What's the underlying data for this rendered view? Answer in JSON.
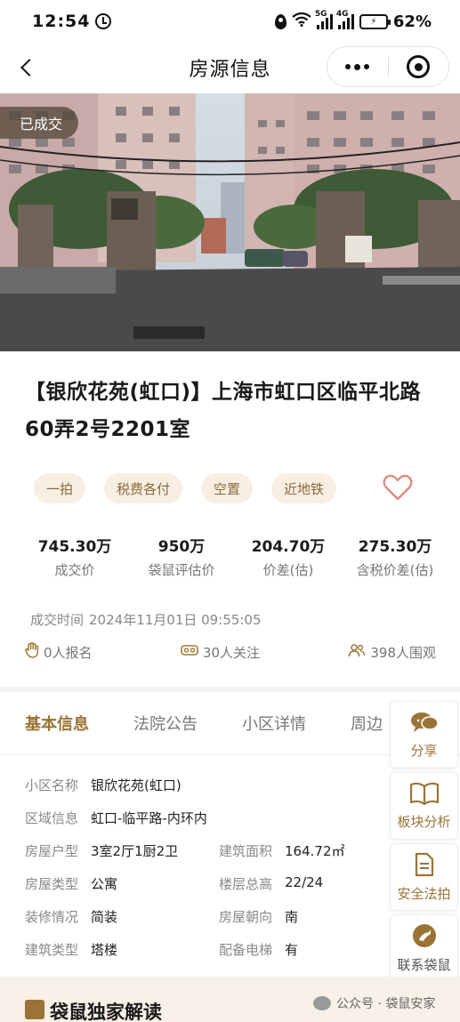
{
  "status_bar": {
    "time": "12:54",
    "signal_5g": "5G",
    "signal_4g": "4G",
    "battery": "62%"
  },
  "nav": {
    "title": "房源信息"
  },
  "hero": {
    "badge": "已成交"
  },
  "listing": {
    "title": "【银欣花苑(虹口)】上海市虹口区临平北路60弄2号2201室",
    "tags": [
      "一拍",
      "税费各付",
      "空置",
      "近地铁"
    ],
    "stats": [
      {
        "value": "745.30万",
        "label": "成交价"
      },
      {
        "value": "950万",
        "label": "袋鼠评估价"
      },
      {
        "value": "204.70万",
        "label": "价差(估)"
      },
      {
        "value": "275.30万",
        "label": "含税价差(估)"
      }
    ],
    "deal_time_label": "成交时间",
    "deal_time": "2024年11月01日 09:55:05",
    "signups": "0人报名",
    "followers": "30人关注",
    "watchers": "398人围观"
  },
  "tabs": [
    "基本信息",
    "法院公告",
    "小区详情",
    "周边"
  ],
  "info": {
    "rows": [
      [
        {
          "label": "小区名称",
          "value": "银欣花苑(虹口)"
        }
      ],
      [
        {
          "label": "区域信息",
          "value": "虹口-临平路-内环内"
        }
      ],
      [
        {
          "label": "房屋户型",
          "value": "3室2厅1厨2卫"
        },
        {
          "label": "建筑面积",
          "value": "164.72㎡"
        }
      ],
      [
        {
          "label": "房屋类型",
          "value": "公寓"
        },
        {
          "label": "楼层总高",
          "value": "22/24"
        }
      ],
      [
        {
          "label": "装修情况",
          "value": "简装"
        },
        {
          "label": "房屋朝向",
          "value": "南"
        }
      ],
      [
        {
          "label": "建筑类型",
          "value": "塔楼"
        },
        {
          "label": "配备电梯",
          "value": "有"
        }
      ]
    ]
  },
  "side_buttons": {
    "share": "分享",
    "analysis": "板块分析",
    "legal": "安全法拍",
    "contact": "联系袋鼠"
  },
  "bottom": {
    "section_title": "袋鼠独家解读",
    "watermark": "公众号 · 袋鼠安家"
  },
  "colors": {
    "accent_gold": "#9a7436",
    "tag_bg": "#f8efe2",
    "favorite": "#e08a7a"
  }
}
